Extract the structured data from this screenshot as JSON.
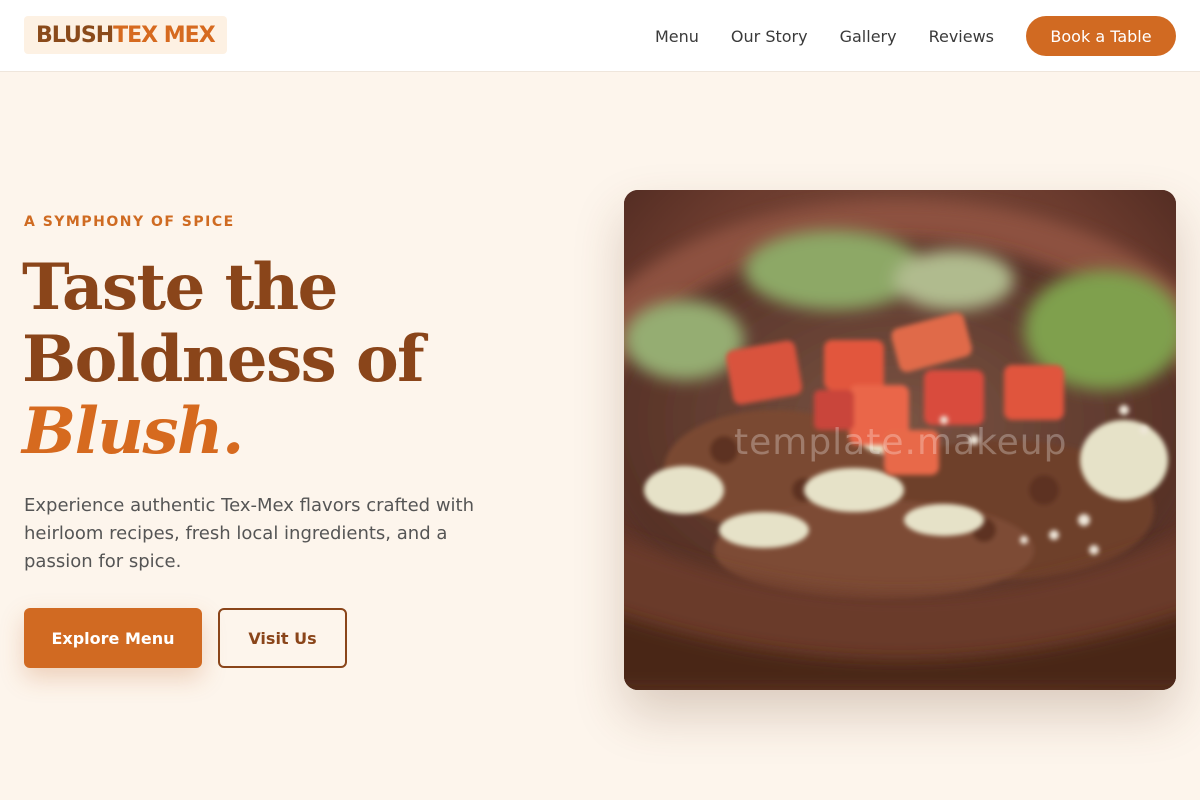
{
  "brand": {
    "word_a": "BLUSH ",
    "word_b": "TEX MEX"
  },
  "nav": {
    "links": [
      "Menu",
      "Our Story",
      "Gallery",
      "Reviews"
    ],
    "cta": "Book a Table"
  },
  "hero": {
    "eyebrow": "A SYMPHONY OF SPICE",
    "headline_line1": "Taste the",
    "headline_line2": "Boldness of",
    "headline_accent": "Blush.",
    "description": "Experience authentic Tex-Mex flavors crafted with heirloom recipes, fresh local ingredients, and a passion for spice.",
    "primary_button": "Explore Menu",
    "secondary_button": "Visit Us",
    "image_watermark": "template.makeup"
  },
  "colors": {
    "accent": "#d16a22",
    "brand_dark": "#8a451a",
    "background": "#fdf5ec"
  },
  "icons": {
    "hero_image": "food-bowl-photo"
  }
}
